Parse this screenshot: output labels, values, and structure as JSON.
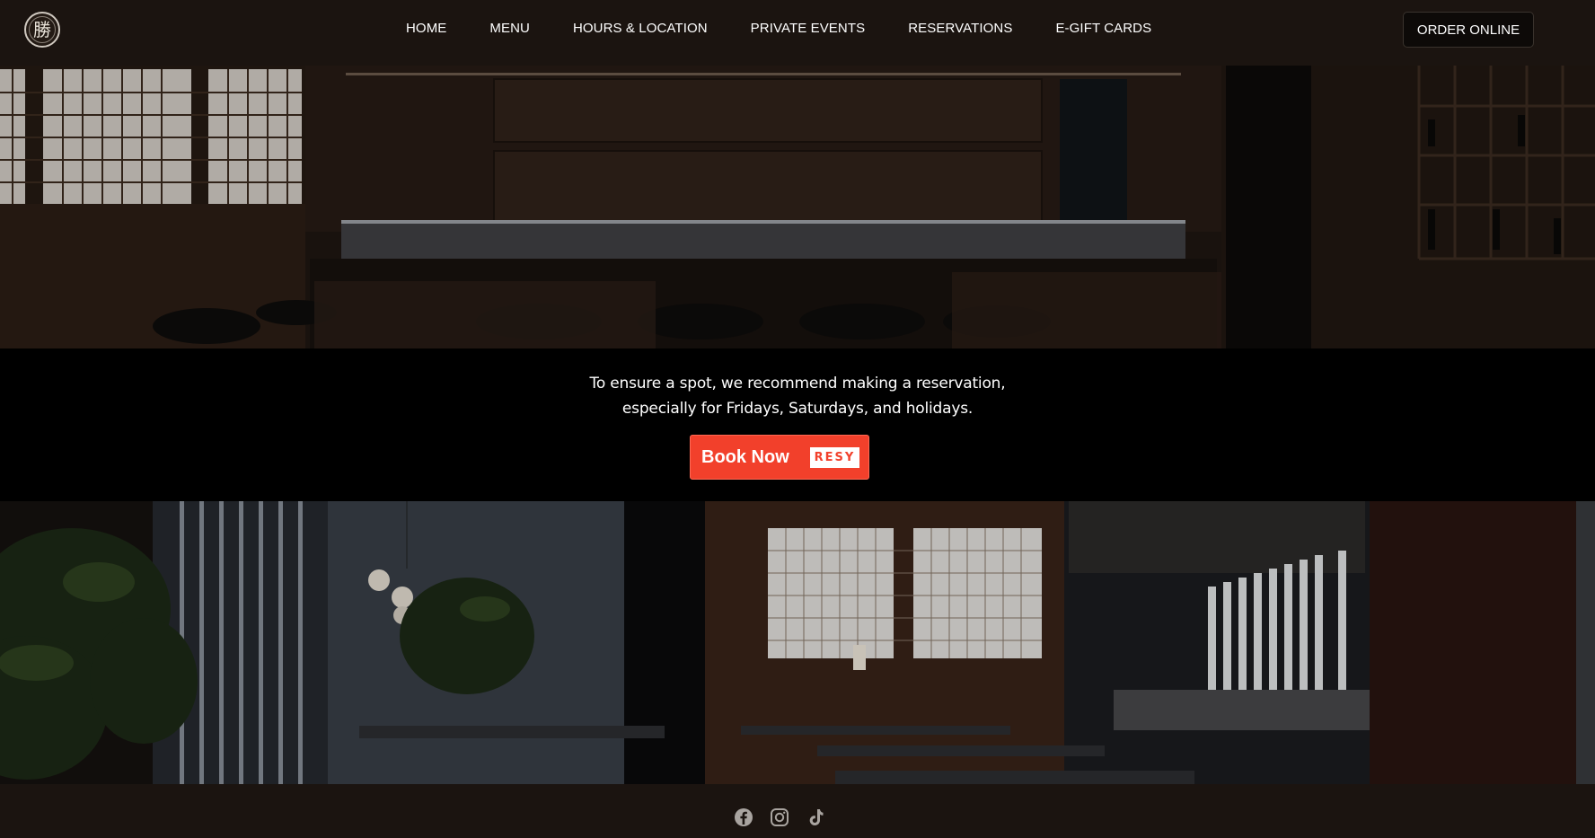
{
  "logo": {
    "glyph": "勝"
  },
  "nav": {
    "items": [
      {
        "label": "HOME"
      },
      {
        "label": "MENU"
      },
      {
        "label": "HOURS & LOCATION"
      },
      {
        "label": "PRIVATE EVENTS"
      },
      {
        "label": "RESERVATIONS"
      },
      {
        "label": "E-GIFT CARDS"
      }
    ],
    "order_online": "ORDER ONLINE"
  },
  "reservation": {
    "line1": "To ensure a spot, we recommend making a reservation,",
    "line2": "especially for Fridays, Saturdays, and holidays.",
    "book_label": "Book Now",
    "resy_label": "RESY"
  },
  "footer": {
    "social": [
      "facebook-icon",
      "instagram-icon",
      "tiktok-icon"
    ]
  },
  "colors": {
    "header_bg": "#1b1410",
    "accent": "#f2402b"
  }
}
